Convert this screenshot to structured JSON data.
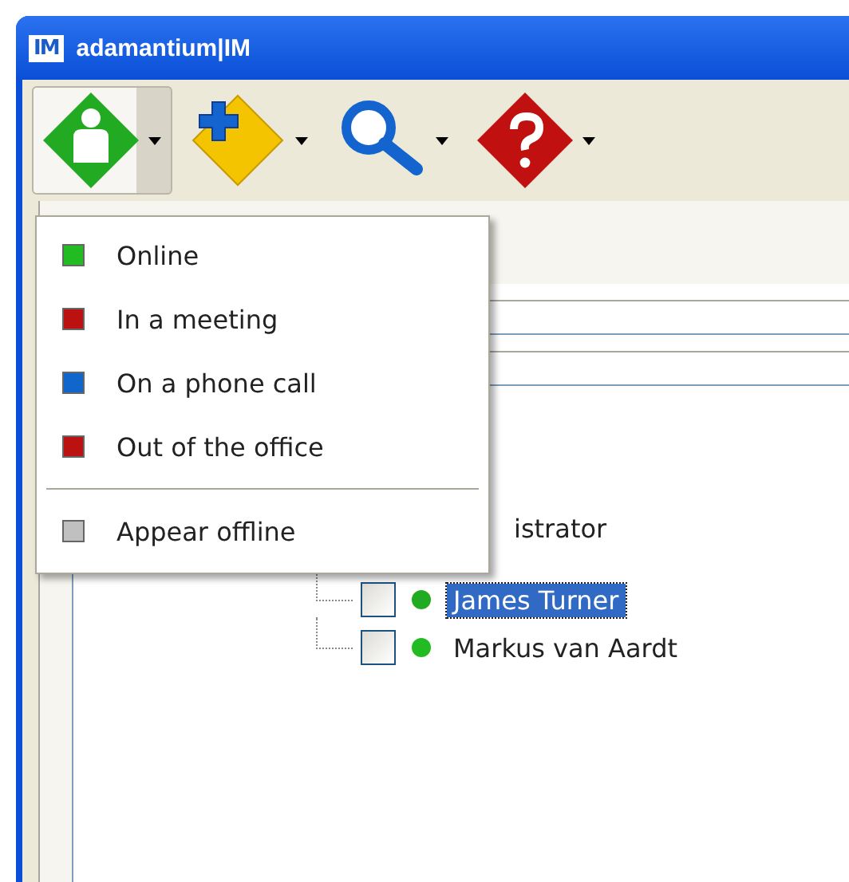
{
  "window": {
    "title": "adamantium|IM",
    "icon": "IM"
  },
  "toolbar": [
    {
      "kind": "status",
      "pressed": true
    },
    {
      "kind": "add",
      "pressed": false
    },
    {
      "kind": "search",
      "pressed": false
    },
    {
      "kind": "help",
      "pressed": false
    }
  ],
  "status_menu": {
    "items": [
      {
        "label": "Online",
        "color": "#22bb22"
      },
      {
        "label": "In a meeting",
        "color": "#bb1111"
      },
      {
        "label": "On a phone call",
        "color": "#1166cc"
      },
      {
        "label": "Out of the office",
        "color": "#bb1111"
      }
    ],
    "offline_item": {
      "label": "Appear offline",
      "color": "#c0c0c0"
    }
  },
  "tree": {
    "label": "istrator",
    "children": [
      {
        "label": "James Turner",
        "checked": false,
        "selected": true,
        "color": "#22aa22"
      },
      {
        "label": "Markus van Aardt",
        "checked": false,
        "selected": false,
        "color": "#22bb22"
      }
    ]
  }
}
